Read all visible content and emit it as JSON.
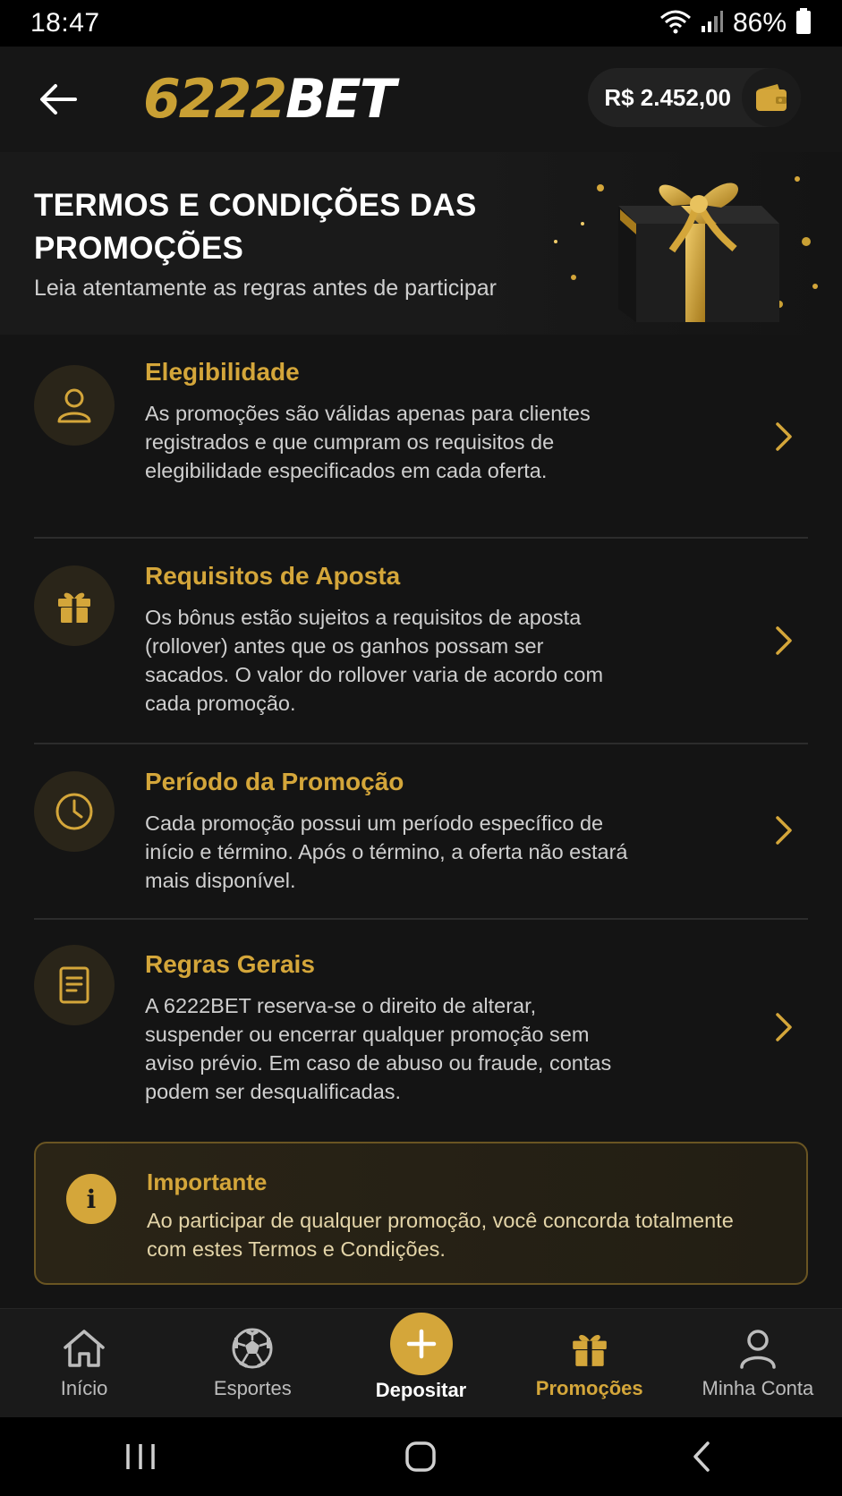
{
  "status_bar": {
    "time": "18:47",
    "battery": "86%"
  },
  "header": {
    "logo_number": "6222",
    "logo_text": "BET",
    "balance": "R$ 2.452,00"
  },
  "banner": {
    "title": "TERMOS E CONDIÇÕES DAS PROMOÇÕES",
    "subtitle": "Leia atentamente as regras antes de participar"
  },
  "sections": [
    {
      "icon": "user-icon",
      "title": "Elegibilidade",
      "text": "As promoções são válidas apenas para clientes registrados e que cumpram os requisitos de elegibilidade especificados em cada oferta."
    },
    {
      "icon": "gift-icon",
      "title": "Requisitos de Aposta",
      "text": "Os bônus estão sujeitos a requisitos de aposta (rollover) antes que os ganhos possam ser sacados. O valor do rollover varia de acordo com cada promoção."
    },
    {
      "icon": "clock-icon",
      "title": "Período da Promoção",
      "text": "Cada promoção possui um período específico de início e término. Após o término, a oferta não estará mais disponível."
    },
    {
      "icon": "document-icon",
      "title": "Regras Gerais",
      "text": "A 6222BET reserva-se o direito de alterar, suspender ou encerrar qualquer promoção sem aviso prévio. Em caso de abuso ou fraude, contas podem ser desqualificadas."
    }
  ],
  "important": {
    "icon_glyph": "i",
    "title": "Importante",
    "text": "Ao participar de qualquer promoção, você concorda totalmente com estes Termos e Condições."
  },
  "bottom_nav": [
    {
      "label": "Início",
      "icon": "home-icon"
    },
    {
      "label": "Esportes",
      "icon": "soccer-ball-icon"
    },
    {
      "label": "Depositar",
      "icon": "plus-icon"
    },
    {
      "label": "Promoções",
      "icon": "gift-icon",
      "active": true
    },
    {
      "label": "Minha Conta",
      "icon": "user-icon"
    }
  ],
  "colors": {
    "accent": "#d4a63a",
    "background": "#141414",
    "header": "#161616"
  }
}
